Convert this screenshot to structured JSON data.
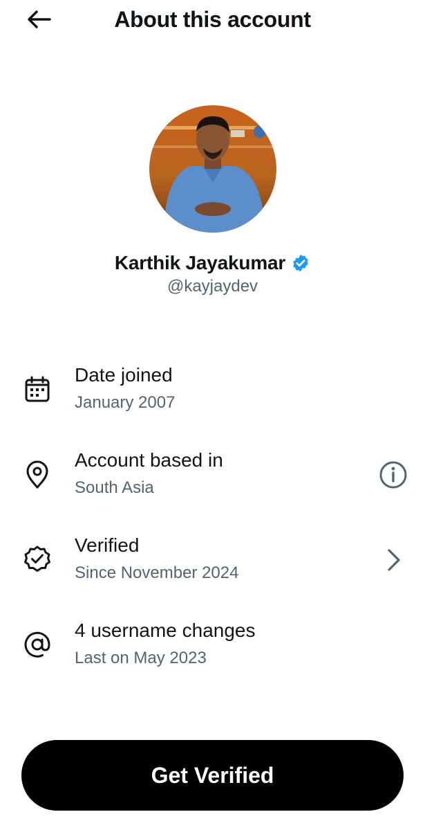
{
  "header": {
    "title": "About this account"
  },
  "profile": {
    "display_name": "Karthik Jayakumar",
    "handle": "@kayjaydev",
    "verified_badge_color": "#1d9bf0"
  },
  "rows": [
    {
      "icon": "calendar-icon",
      "title": "Date joined",
      "subtitle": "January 2007"
    },
    {
      "icon": "location-pin-icon",
      "title": "Account based in",
      "subtitle": "South Asia",
      "action_icon": "info-icon"
    },
    {
      "icon": "verified-badge-icon",
      "title": "Verified",
      "subtitle": "Since November 2024",
      "action_icon": "chevron-right-icon"
    },
    {
      "icon": "at-sign-icon",
      "title": "4 username changes",
      "subtitle": "Last on May 2023"
    }
  ],
  "cta": {
    "label": "Get Verified"
  },
  "colors": {
    "text_primary": "#0f1419",
    "text_secondary": "#536471",
    "cta_background": "#000000"
  }
}
